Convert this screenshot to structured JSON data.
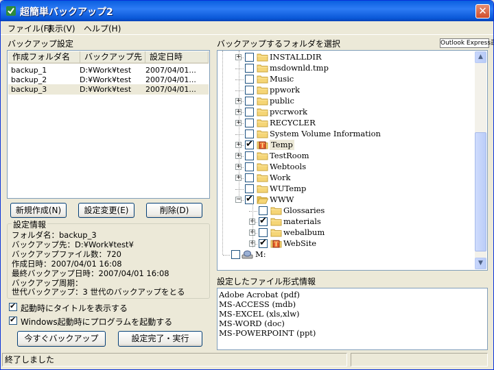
{
  "window": {
    "title": "超簡単バックアップ2",
    "close_glyph": "✕"
  },
  "menu": {
    "file": "ファイル(F)",
    "view": "表示(V)",
    "help": "ヘルプ(H)"
  },
  "left": {
    "backup_settings_label": "バックアップ設定",
    "columns": [
      "作成フォルダ名",
      "バックアップ先",
      "設定日時"
    ],
    "rows": [
      {
        "name": "backup_1",
        "dest": "D:¥Work¥test",
        "date": "2007/04/01..."
      },
      {
        "name": "backup_2",
        "dest": "D:¥Work¥test",
        "date": "2007/04/01..."
      },
      {
        "name": "backup_3",
        "dest": "D:¥Work¥test",
        "date": "2007/04/01..."
      }
    ],
    "selected_row": 2,
    "buttons": {
      "new": "新規作成(N)",
      "edit": "設定変更(E)",
      "delete": "削除(D)"
    },
    "info": {
      "title": "設定情報",
      "lines": [
        "フォルダ名：backup_3",
        "バックアップ先：D:¥Work¥test¥",
        "バックアップファイル数：720",
        "作成日時：2007/04/01 16:08",
        "最終バックアップ日時：2007/04/01 16:08",
        "バックアップ周期：",
        "世代バックアップ：3 世代のバックアップをとる"
      ]
    },
    "options": [
      {
        "label": "起動時にタイトルを表示する",
        "checked": true
      },
      {
        "label": "Windows起動時にプログラムを起動する",
        "checked": true
      }
    ],
    "backup_now": "今すぐバックアップ",
    "finish_run": "設定完了・実行"
  },
  "right": {
    "select_folder_label": "バックアップするフォルダを選択",
    "outlook_button": "Outlook Express選択",
    "tree": [
      {
        "label": "INSTALLDIR",
        "level": 0,
        "expander": "+",
        "checked": false
      },
      {
        "label": "msdownld.tmp",
        "level": 0,
        "expander": "",
        "checked": false
      },
      {
        "label": "Music",
        "level": 0,
        "expander": "",
        "checked": false
      },
      {
        "label": "ppwork",
        "level": 0,
        "expander": "",
        "checked": false
      },
      {
        "label": "public",
        "level": 0,
        "expander": "+",
        "checked": false
      },
      {
        "label": "pvcrwork",
        "level": 0,
        "expander": "+",
        "checked": false
      },
      {
        "label": "RECYCLER",
        "level": 0,
        "expander": "+",
        "checked": false
      },
      {
        "label": "System Volume Information",
        "level": 0,
        "expander": "",
        "checked": false
      },
      {
        "label": "Temp",
        "level": 0,
        "expander": "+",
        "checked": true,
        "highlight": true,
        "special": true
      },
      {
        "label": "TestRoom",
        "level": 0,
        "expander": "+",
        "checked": false
      },
      {
        "label": "Webtools",
        "level": 0,
        "expander": "+",
        "checked": false
      },
      {
        "label": "Work",
        "level": 0,
        "expander": "+",
        "checked": false
      },
      {
        "label": "WUTemp",
        "level": 0,
        "expander": "",
        "checked": false
      },
      {
        "label": "WWW",
        "level": 0,
        "expander": "−",
        "checked": true,
        "open": true
      },
      {
        "label": "Glossaries",
        "level": 1,
        "expander": "",
        "checked": false
      },
      {
        "label": "materials",
        "level": 1,
        "expander": "+",
        "checked": true
      },
      {
        "label": "webalbum",
        "level": 1,
        "expander": "+",
        "checked": false
      },
      {
        "label": "WebSite",
        "level": 1,
        "expander": "+",
        "checked": true,
        "special": true
      },
      {
        "label": "M:",
        "level": -1,
        "expander": "",
        "checked": false,
        "drive": true
      }
    ],
    "scroll_up": "▲",
    "scroll_down": "▼",
    "filetype_label": "設定したファイル形式情報",
    "filetypes": [
      "Adobe Acrobat (pdf)",
      "MS-ACCESS (mdb)",
      "MS-EXCEL (xls,xlw)",
      "MS-WORD (doc)",
      "MS-POWERPOINT (ppt)"
    ]
  },
  "status": {
    "message": "終了しました",
    "secondary": ""
  },
  "colors": {
    "titlebar": "#0A5FE0",
    "window_bg": "#ECE9D8",
    "folder": "#F5D576",
    "check": "#000000"
  }
}
